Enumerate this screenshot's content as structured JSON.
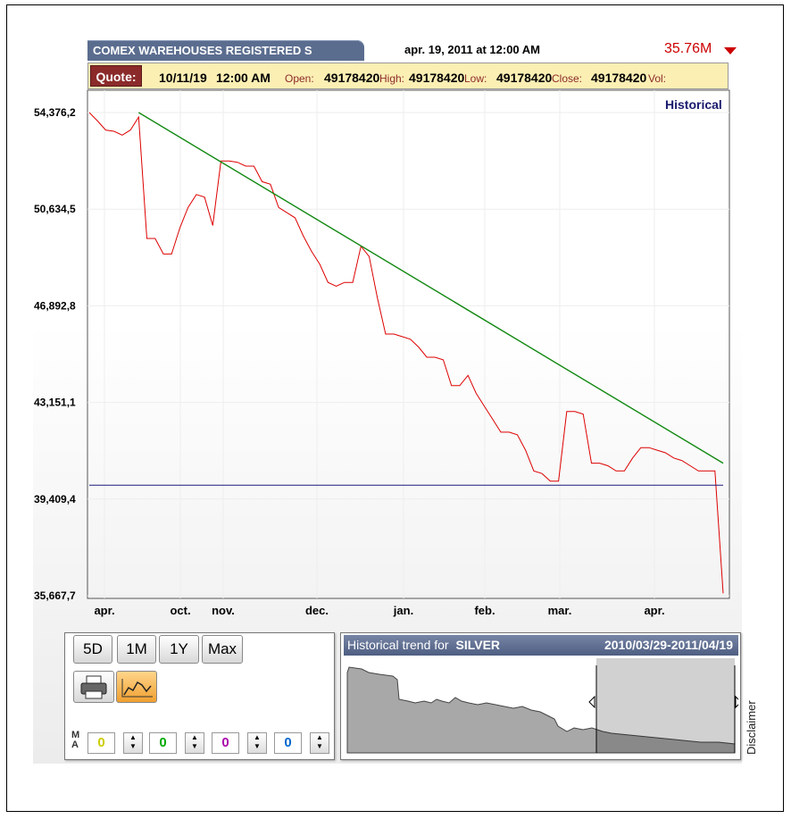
{
  "header": {
    "title": "COMEX WAREHOUSES REGISTERED S",
    "datetime": "apr. 19, 2011 at 12:00 AM",
    "last_value": "35.76M",
    "accent_color": "#cc0000"
  },
  "quote": {
    "button_label": "Quote:",
    "date": "10/11/19",
    "time": "12:00 AM",
    "open_label": "Open:",
    "open_value": "49178420",
    "high_label": "High:",
    "high_value": "49178420",
    "low_label": "Low:",
    "low_value": "49178420",
    "close_label": "Close:",
    "close_value": "49178420",
    "vol_label": "Vol:"
  },
  "chart_mode_label": "Historical",
  "chart_data": {
    "type": "line",
    "y_tick_labels": [
      "54,376,2",
      "50,634,5",
      "46,892,8",
      "43,151,1",
      "39,409,4",
      "35,667,7"
    ],
    "x_tick_labels": [
      "apr.",
      "oct.",
      "nov.",
      "dec.",
      "jan.",
      "feb.",
      "mar.",
      "apr."
    ],
    "ylim": [
      35667740,
      54376200
    ],
    "grid": true,
    "series": [
      {
        "color": "#dd0000",
        "values": [
          [
            0,
            54376200
          ],
          [
            1,
            54050000
          ],
          [
            2,
            53700000
          ],
          [
            3,
            53650000
          ],
          [
            4,
            53500000
          ],
          [
            5,
            53700000
          ],
          [
            6,
            54200000
          ],
          [
            7,
            49500000
          ],
          [
            8,
            49500000
          ],
          [
            9,
            48900000
          ],
          [
            10,
            48900000
          ],
          [
            11,
            49900000
          ],
          [
            12,
            50700000
          ],
          [
            13,
            51200000
          ],
          [
            14,
            51100000
          ],
          [
            15,
            50000000
          ],
          [
            16,
            52500000
          ],
          [
            17,
            52500000
          ],
          [
            18,
            52450000
          ],
          [
            19,
            52300000
          ],
          [
            20,
            52300000
          ],
          [
            21,
            51700000
          ],
          [
            22,
            51600000
          ],
          [
            23,
            50700000
          ],
          [
            24,
            50500000
          ],
          [
            25,
            50300000
          ],
          [
            26,
            49600000
          ],
          [
            27,
            49000000
          ],
          [
            28,
            48500000
          ],
          [
            29,
            47800000
          ],
          [
            30,
            47650000
          ],
          [
            31,
            47800000
          ],
          [
            32,
            47800000
          ],
          [
            33,
            49200000
          ],
          [
            34,
            48800000
          ],
          [
            35,
            47200000
          ],
          [
            36,
            45800000
          ],
          [
            37,
            45800000
          ],
          [
            38,
            45700000
          ],
          [
            39,
            45600000
          ],
          [
            40,
            45300000
          ],
          [
            41,
            44900000
          ],
          [
            42,
            44900000
          ],
          [
            43,
            44800000
          ],
          [
            44,
            43800000
          ],
          [
            45,
            43800000
          ],
          [
            46,
            44200000
          ],
          [
            47,
            43500000
          ],
          [
            48,
            43000000
          ],
          [
            49,
            42500000
          ],
          [
            50,
            42000000
          ],
          [
            51,
            42000000
          ],
          [
            52,
            41900000
          ],
          [
            53,
            41300000
          ],
          [
            54,
            40500000
          ],
          [
            55,
            40400000
          ],
          [
            56,
            40100000
          ],
          [
            57,
            40100000
          ],
          [
            58,
            42800000
          ],
          [
            59,
            42800000
          ],
          [
            60,
            42700000
          ],
          [
            61,
            40800000
          ],
          [
            62,
            40800000
          ],
          [
            63,
            40700000
          ],
          [
            64,
            40500000
          ],
          [
            65,
            40500000
          ],
          [
            66,
            41000000
          ],
          [
            67,
            41400000
          ],
          [
            68,
            41400000
          ],
          [
            69,
            41300000
          ],
          [
            70,
            41200000
          ],
          [
            71,
            41000000
          ],
          [
            72,
            40900000
          ],
          [
            73,
            40700000
          ],
          [
            74,
            40500000
          ],
          [
            75,
            40500000
          ],
          [
            76,
            40500000
          ],
          [
            77,
            35760000
          ]
        ]
      },
      {
        "color": "#118811",
        "values": [
          [
            6,
            54376200
          ],
          [
            77,
            40800000
          ]
        ]
      },
      {
        "color": "#1a1a7a",
        "values": [
          [
            0,
            39950000
          ],
          [
            77,
            39950000
          ]
        ]
      }
    ]
  },
  "controls": {
    "range_buttons": [
      "5D",
      "1M",
      "1Y",
      "Max"
    ],
    "print_icon": "printer-icon",
    "chart_style_icon": "line-chart-icon",
    "ma_label_top": "M",
    "ma_label_bottom": "A",
    "ma_values": [
      "0",
      "0",
      "0",
      "0"
    ],
    "ma_colors": [
      "#cccc00",
      "#00aa00",
      "#aa00aa",
      "#0066cc"
    ]
  },
  "trend": {
    "prefix": "Historical trend for",
    "symbol": "SILVER",
    "date_range": "2010/03/29-2011/04/19"
  },
  "disclaimer_label": "Disclaimer"
}
